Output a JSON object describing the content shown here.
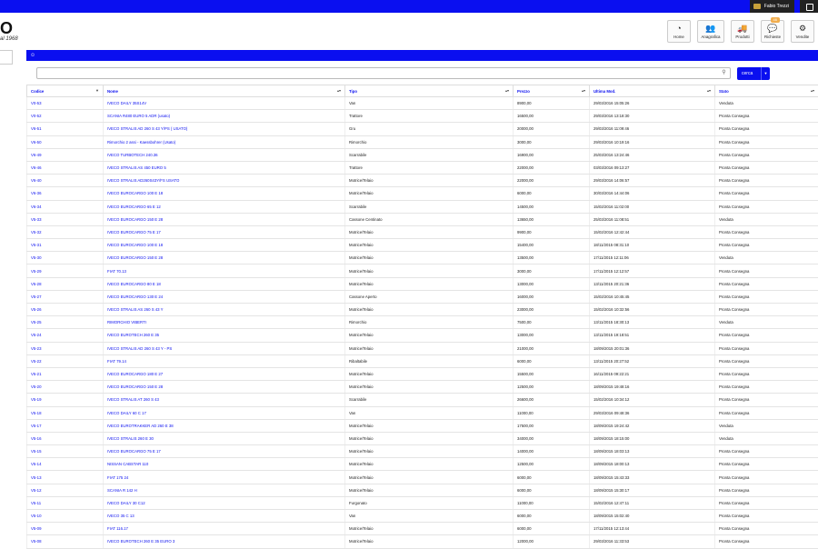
{
  "topbar": {
    "user_label": "Fabio Trezzi"
  },
  "brand": {
    "logo_text": "O",
    "tagline": "al 1968"
  },
  "nav": [
    {
      "label": "Home",
      "icon": "dashboard-icon",
      "glyph": "◔",
      "badge": ""
    },
    {
      "label": "Anagrafica",
      "icon": "users-icon",
      "glyph": "👥",
      "badge": ""
    },
    {
      "label": "Prodotti",
      "icon": "truck-icon",
      "glyph": "🚚",
      "badge": ""
    },
    {
      "label": "Richieste",
      "icon": "comments-icon",
      "glyph": "💬",
      "badge": "46"
    },
    {
      "label": "Vendite",
      "icon": "cogs-icon",
      "glyph": "⚙",
      "badge": ""
    }
  ],
  "search": {
    "placeholder": "",
    "button_label": "cerca"
  },
  "table": {
    "columns": [
      "Codice",
      "Nome",
      "Tipo",
      "Prezzo",
      "Ultima Mod.",
      "Stato"
    ],
    "rows": [
      [
        "V0-53",
        "IVECO DAILY 35S14V",
        "Van",
        "8900,00",
        "29/03/2016 15:05:26",
        "Venduta"
      ],
      [
        "V0-52",
        "SCANIA R480 EURO 5 ADR (usato)",
        "Trattore",
        "16500,00",
        "29/03/2016 13:18:30",
        "Pronta Consegna"
      ],
      [
        "V6-51",
        "IVECO STRALIS AD 260 S 43 Y/PS ( USATO)",
        "Gru",
        "20000,00",
        "29/03/2016 11:09:46",
        "Pronta Consegna"
      ],
      [
        "V6-50",
        "Rimorchio 2 assi - Kaessbohrer (Usato)",
        "Rimorchio",
        "3000,00",
        "29/03/2016 10:19:16",
        "Pronta Consegna"
      ],
      [
        "V6-49",
        "IVECO TURBOTECH 240.36",
        "Scarrabile",
        "16900,00",
        "25/03/2016 13:24:46",
        "Pronta Consegna"
      ],
      [
        "V6-46",
        "IVECO STRALIS AS 450 EURO 5",
        "Trattore",
        "22000,00",
        "03/03/2016 09:13:27",
        "Pronta Consegna"
      ],
      [
        "V6-40",
        "IVECO STRALIS AD260S43Y/FS USATO",
        "Motrice/Telaio",
        "22000,00",
        "29/03/2016 14:06:57",
        "Pronta Consegna"
      ],
      [
        "V6-36",
        "IVECO EUROCARGO 100 E 18",
        "Motrice/Telaio",
        "6000,00",
        "30/03/2016 14:44:06",
        "Pronta Consegna"
      ],
      [
        "V6-34",
        "IVECO EUROCARGO 65 E 12",
        "Scarrabile",
        "14500,00",
        "15/02/2016 11:02:00",
        "Pronta Consegna"
      ],
      [
        "V5-33",
        "IVECO EUROCARGO 150 E 28",
        "Cassone Centinato",
        "13650,00",
        "25/03/2016 11:08:51",
        "Venduta"
      ],
      [
        "V5-32",
        "IVECO EUROCARGO 75 E 17",
        "Motrice/Telaio",
        "9900,00",
        "15/02/2016 12:42:44",
        "Pronta Consegna"
      ],
      [
        "V5-31",
        "IVECO EUROCARGO 100 E 18",
        "Motrice/Telaio",
        "15400,00",
        "18/11/2015 08:31:10",
        "Pronta Consegna"
      ],
      [
        "V5-30",
        "IVECO EUROCARGO 150 E 28",
        "Motrice/Telaio",
        "13500,00",
        "17/11/2015 12:11:06",
        "Venduta"
      ],
      [
        "V5-29",
        "FIAT 70.13",
        "Motrice/Telaio",
        "3000,00",
        "17/11/2015 12:12:57",
        "Pronta Consegna"
      ],
      [
        "V5-28",
        "IVECO EUROCARGO 80 E 18",
        "Motrice/Telaio",
        "13000,00",
        "13/11/2015 20:21:36",
        "Pronta Consegna"
      ],
      [
        "V5-27",
        "IVECO EUROCARGO 130 E 24",
        "Cassone Aperto",
        "16000,00",
        "15/02/2016 10:45:45",
        "Pronta Consegna"
      ],
      [
        "V5-26",
        "IVECO STRALIS AS 260 S 43 Y",
        "Motrice/Telaio",
        "23000,00",
        "15/02/2016 10:32:56",
        "Pronta Consegna"
      ],
      [
        "V5-25",
        "RIMORCHIO VIBERTI",
        "Rimorchio",
        "7500,00",
        "13/11/2015 18:30:13",
        "Venduta"
      ],
      [
        "V5-24",
        "IVECO EUROTECH 260 E 35",
        "Motrice/Telaio",
        "13000,00",
        "13/11/2015 19:18:51",
        "Pronta Consegna"
      ],
      [
        "V5-23",
        "IVECO STRALIS AD 260 S 43 Y - PS",
        "Motrice/Telaio",
        "21000,00",
        "18/09/2015 20:01:36",
        "Pronta Consegna"
      ],
      [
        "V5-22",
        "FIAT 79.14",
        "Ribaltabile",
        "6000,00",
        "13/11/2015 20:27:52",
        "Pronta Consegna"
      ],
      [
        "V5-21",
        "IVECO EUROCARGO 180 E 27",
        "Motrice/Telaio",
        "15500,00",
        "16/11/2015 09:22:21",
        "Pronta Consegna"
      ],
      [
        "V5-20",
        "IVECO EUROCARGO 150 E 28",
        "Motrice/Telaio",
        "12500,00",
        "18/09/2015 19:48:16",
        "Pronta Consegna"
      ],
      [
        "V5-19",
        "IVECO STRALIS AT 260 S 43",
        "Scarrabile",
        "26600,00",
        "15/02/2016 10:34:12",
        "Pronta Consegna"
      ],
      [
        "V5-18",
        "IVECO DAILY 60 C 17",
        "Van",
        "11000,00",
        "29/03/2016 09:48:36",
        "Pronta Consegna"
      ],
      [
        "V5-17",
        "IVECO EUROTRAKKER AD 260 E 38",
        "Motrice/Telaio",
        "17500,00",
        "18/09/2015 19:24:42",
        "Venduta"
      ],
      [
        "V5-16",
        "IVECO STRALIS 260 E 30",
        "Motrice/Telaio",
        "34000,00",
        "18/09/2015 18:15:00",
        "Venduta"
      ],
      [
        "V5-15",
        "IVECO EUROCARGO 75 E 17",
        "Motrice/Telaio",
        "14000,00",
        "18/09/2015 18:03:13",
        "Pronta Consegna"
      ],
      [
        "V5-14",
        "NISSAN CABSTAR 110",
        "Motrice/Telaio",
        "12500,00",
        "18/09/2015 18:00:13",
        "Pronta Consegna"
      ],
      [
        "V5-13",
        "FIAT 175 24",
        "Motrice/Telaio",
        "6000,00",
        "18/09/2015 15:43:33",
        "Pronta Consegna"
      ],
      [
        "V5-12",
        "SCANIA R 142 H",
        "Motrice/Telaio",
        "6000,00",
        "18/09/2015 15:30:17",
        "Pronta Consegna"
      ],
      [
        "V5-11",
        "IVECO DAILY 30 C12",
        "Furgonato",
        "11000,00",
        "15/02/2016 12:47:11",
        "Pronta Consegna"
      ],
      [
        "V5-10",
        "IVECO 35 C 13",
        "Van",
        "6000,00",
        "18/09/2015 15:02:40",
        "Pronta Consegna"
      ],
      [
        "V5-09",
        "FIAT 116.17",
        "Motrice/Telaio",
        "6000,00",
        "17/11/2015 12:13:44",
        "Pronta Consegna"
      ],
      [
        "V5-08",
        "IVECO EUROTECH 260 E 35 EURO 3",
        "Motrice/Telaio",
        "12000,00",
        "29/03/2016 11:33:53",
        "Pronta Consegna"
      ]
    ]
  }
}
